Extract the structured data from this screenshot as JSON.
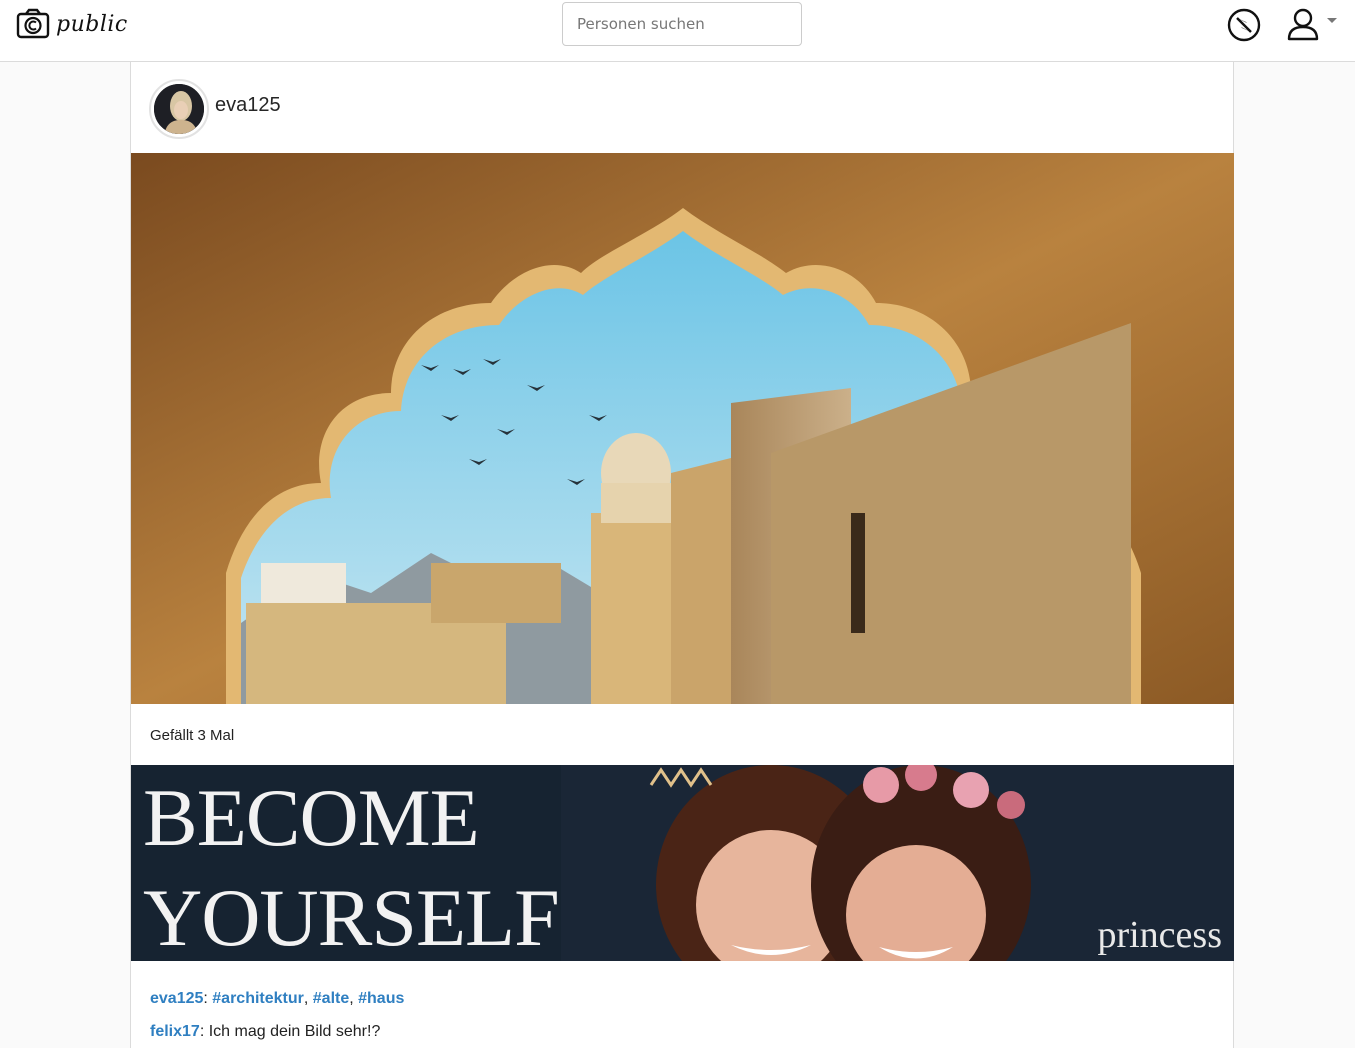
{
  "app": {
    "logo_text": "public"
  },
  "search": {
    "placeholder": "Personen suchen",
    "value": ""
  },
  "nav": {
    "explore_icon": "compass-icon",
    "profile_icon": "user-icon",
    "menu_icon": "caret-down-icon"
  },
  "post": {
    "author": "eva125",
    "likes_text": "Gefällt 3 Mal",
    "banner": {
      "line1": "BECOME",
      "line2": "YOURSELF",
      "sub": "princess"
    },
    "caption": {
      "user": "eva125",
      "tags": [
        "#architektur",
        "#alte",
        "#haus"
      ]
    },
    "comments": [
      {
        "user": "felix17",
        "text": ": Ich mag dein Bild sehr!?"
      }
    ]
  },
  "colors": {
    "link": "#2f7fc1",
    "border": "#dbdbdb",
    "page_bg": "#fafafa"
  }
}
